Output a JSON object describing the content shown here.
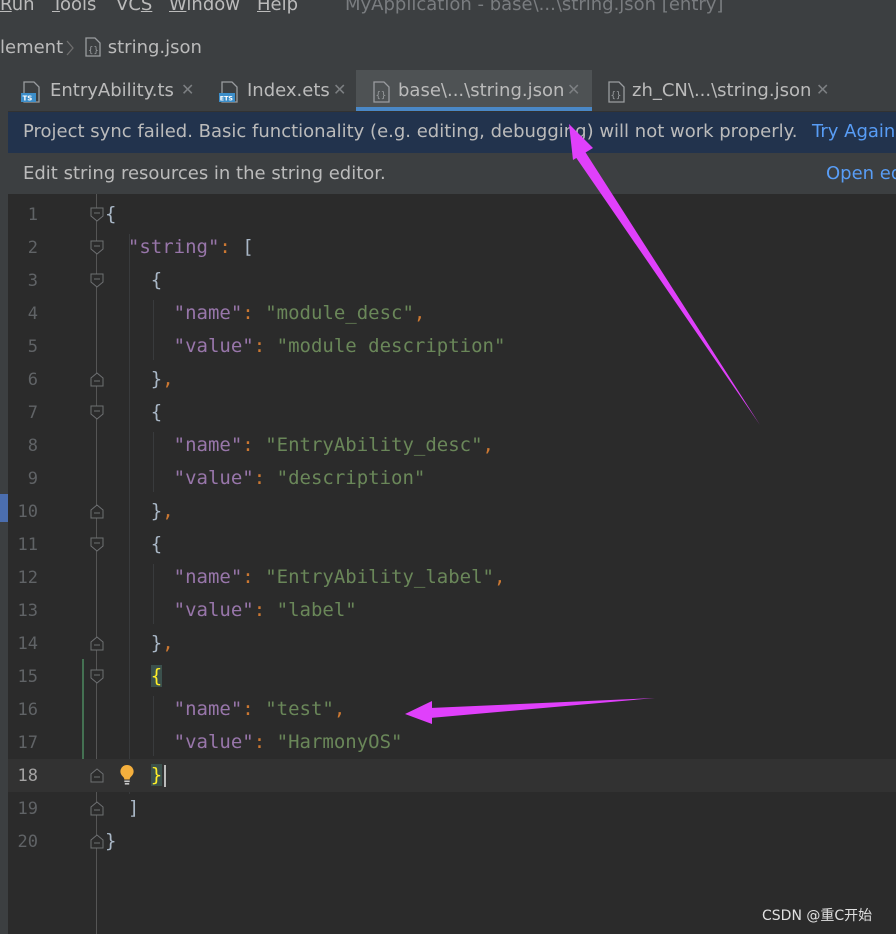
{
  "menu": {
    "items": [
      {
        "label": "Run",
        "mnemonic_index": 0
      },
      {
        "label": "Tools",
        "mnemonic_index": 0
      },
      {
        "label": "VCS",
        "mnemonic_index": 2
      },
      {
        "label": "Window",
        "mnemonic_index": 0
      },
      {
        "label": "Help",
        "mnemonic_index": 0
      }
    ],
    "window_title": "MyApplication - base\\...\\string.json [entry]"
  },
  "breadcrumb": {
    "items": [
      "lement",
      "string.json"
    ],
    "file_icon": "json-file-icon"
  },
  "tabs": [
    {
      "label": "EntryAbility.ts",
      "icon": "ts-file-icon",
      "icon_text": "TS",
      "icon_color": "#3d8ec9",
      "active": false
    },
    {
      "label": "Index.ets",
      "icon": "ets-file-icon",
      "icon_text": "ETS",
      "icon_color": "#3d8ec9",
      "active": false
    },
    {
      "label": "base\\...\\string.json",
      "icon": "json-file-icon",
      "active": true
    },
    {
      "label": "zh_CN\\...\\string.json",
      "icon": "json-file-icon",
      "active": false
    }
  ],
  "banners": {
    "sync": {
      "message": "Project sync failed. Basic functionality (e.g. editing, debugging) will not work properly.",
      "action": "Try Again"
    },
    "string_editor": {
      "message": "Edit string resources in the string editor.",
      "action": "Open editor"
    }
  },
  "editor": {
    "current_line": 18,
    "lines": [
      {
        "n": "1"
      },
      {
        "n": "2"
      },
      {
        "n": "3"
      },
      {
        "n": "4"
      },
      {
        "n": "5"
      },
      {
        "n": "6"
      },
      {
        "n": "7"
      },
      {
        "n": "8"
      },
      {
        "n": "9"
      },
      {
        "n": "10"
      },
      {
        "n": "11"
      },
      {
        "n": "12"
      },
      {
        "n": "13"
      },
      {
        "n": "14"
      },
      {
        "n": "15"
      },
      {
        "n": "16"
      },
      {
        "n": "17"
      },
      {
        "n": "18"
      },
      {
        "n": "19"
      },
      {
        "n": "20"
      }
    ],
    "tokens": {
      "string_key": "\"string\"",
      "name_key": "\"name\"",
      "value_key": "\"value\"",
      "v_module_desc": "\"module_desc\"",
      "v_module_description": "\"module description\"",
      "v_entry_desc": "\"EntryAbility_desc\"",
      "v_description": "\"description\"",
      "v_entry_label": "\"EntryAbility_label\"",
      "v_label": "\"label\"",
      "v_test": "\"test\"",
      "v_harmony": "\"HarmonyOS\""
    }
  },
  "colors": {
    "key": "#9876aa",
    "string": "#6a8759",
    "punct": "#cc7832",
    "annotation_arrow": "#e040fb",
    "accent": "#4a88c7",
    "link": "#589df6"
  },
  "watermark": "CSDN @重C开始"
}
